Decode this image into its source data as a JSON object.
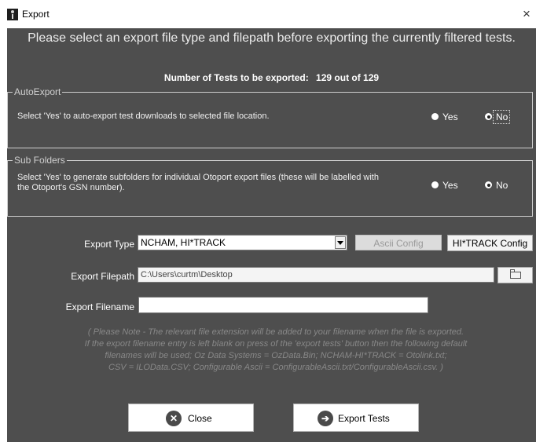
{
  "window": {
    "title": "Export",
    "close_glyph": "×",
    "app_icon": "app-icon"
  },
  "header": {
    "instruction": "Please select an export file type and filepath before exporting the currently filtered tests."
  },
  "summary": {
    "label": "Number of Tests to be exported:",
    "value": "129 out of 129"
  },
  "auto_export": {
    "legend": "AutoExport",
    "description": "Select 'Yes' to auto-export test downloads to selected file location.",
    "yes_label": "Yes",
    "no_label": "No",
    "selected": "No"
  },
  "sub_folders": {
    "legend": "Sub Folders",
    "description": "Select 'Yes' to generate subfolders for individual Otoport export files (these will be labelled with the Otoport's GSN number).",
    "yes_label": "Yes",
    "no_label": "No",
    "selected": "No"
  },
  "export_type": {
    "label": "Export Type",
    "value": "NCHAM, HI*TRACK",
    "ascii_config_label": "Ascii Config",
    "hitrack_config_label": "HI*TRACK Config"
  },
  "export_filepath": {
    "label": "Export Filepath",
    "value": "C:\\Users\\curtm\\Desktop",
    "browse_icon": "folder-icon"
  },
  "export_filename": {
    "label": "Export Filename",
    "value": ""
  },
  "note": {
    "line1": "( Please Note - The relevant file extension will be added to your filename when the file is exported.",
    "line2": "If the export filename entry is left blank on press of the 'export tests' button then the following default",
    "line3": "filenames will be used; Oz Data Systems = OzData.Bin; NCHAM-HI*TRACK = Otolink.txt;",
    "line4": "CSV = ILOData.CSV; Configurable Ascii = ConfigurableAscii.txt/ConfigurableAscii.csv. )"
  },
  "buttons": {
    "close_label": "Close",
    "close_icon_glyph": "✕",
    "export_label": "Export Tests",
    "export_icon_glyph": "➔"
  },
  "colors": {
    "panel_bg": "#4e4e4e",
    "titlebar_bg": "#ffffff",
    "note_text": "#888888"
  }
}
